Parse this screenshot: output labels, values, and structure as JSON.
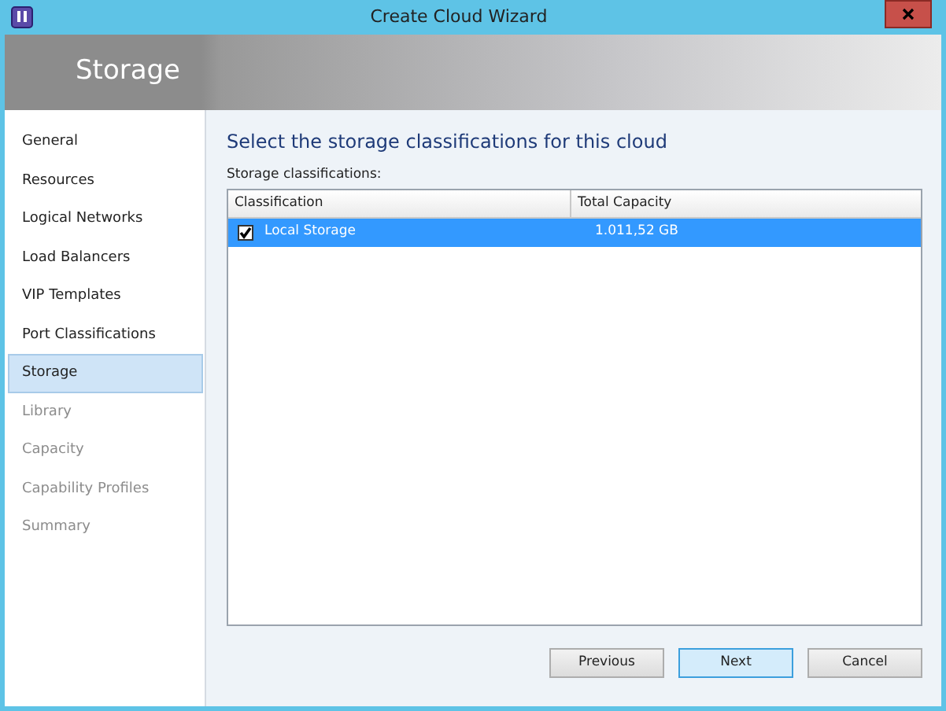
{
  "window": {
    "title": "Create Cloud Wizard"
  },
  "header": {
    "title": "Storage"
  },
  "sidebar": {
    "items": [
      {
        "label": "General",
        "selected": false,
        "disabled": false
      },
      {
        "label": "Resources",
        "selected": false,
        "disabled": false
      },
      {
        "label": "Logical Networks",
        "selected": false,
        "disabled": false
      },
      {
        "label": "Load Balancers",
        "selected": false,
        "disabled": false
      },
      {
        "label": "VIP Templates",
        "selected": false,
        "disabled": false
      },
      {
        "label": "Port Classifications",
        "selected": false,
        "disabled": false
      },
      {
        "label": "Storage",
        "selected": true,
        "disabled": false
      },
      {
        "label": "Library",
        "selected": false,
        "disabled": true
      },
      {
        "label": "Capacity",
        "selected": false,
        "disabled": true
      },
      {
        "label": "Capability Profiles",
        "selected": false,
        "disabled": true
      },
      {
        "label": "Summary",
        "selected": false,
        "disabled": true
      }
    ]
  },
  "content": {
    "heading": "Select the storage classifications for this cloud",
    "list_label": "Storage classifications:"
  },
  "table": {
    "columns": [
      "Classification",
      "Total Capacity"
    ],
    "rows": [
      {
        "cells": [
          "Local Storage",
          "1.011,52 GB"
        ],
        "checked": true,
        "selected": true
      }
    ]
  },
  "buttons": [
    {
      "label": "Previous",
      "hovered": false
    },
    {
      "label": "Next",
      "hovered": true
    },
    {
      "label": "Cancel",
      "hovered": false
    }
  ]
}
